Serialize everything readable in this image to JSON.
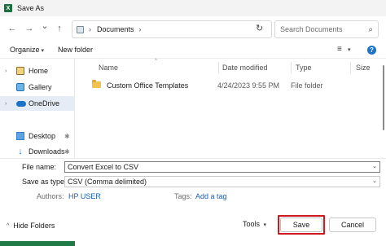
{
  "window": {
    "title": "Save As",
    "app_icon": "excel-icon"
  },
  "nav": {
    "back_icon": "←",
    "forward_icon": "→",
    "dropdown_icon": "⌄",
    "up_icon": "↑",
    "breadcrumb": [
      "Documents"
    ],
    "refresh_icon": "↻",
    "search_placeholder": "Search Documents",
    "search_icon": "⌕"
  },
  "commandbar": {
    "organize_label": "Organize",
    "new_folder_label": "New folder",
    "view_icon": "≡",
    "help_icon": "?"
  },
  "sidebar": {
    "items": [
      {
        "label": "Home",
        "icon": "home-icon",
        "selected": false
      },
      {
        "label": "Gallery",
        "icon": "gallery-icon",
        "selected": false
      },
      {
        "label": "OneDrive",
        "icon": "onedrive-icon",
        "selected": true
      },
      {
        "label": "Desktop",
        "icon": "desktop-icon",
        "pinned": true
      },
      {
        "label": "Downloads",
        "icon": "downloads-icon",
        "pinned": true
      }
    ]
  },
  "filelist": {
    "columns": [
      "Name",
      "Date modified",
      "Type",
      "Size"
    ],
    "rows": [
      {
        "name": "Custom Office Templates",
        "date": "4/24/2023 9:55 PM",
        "type": "File folder",
        "size": ""
      }
    ]
  },
  "form": {
    "filename_label": "File name:",
    "filename_value": "Convert Excel to CSV",
    "savetype_label": "Save as type:",
    "savetype_value": "CSV (Comma delimited)",
    "authors_label": "Authors:",
    "authors_value": "HP USER",
    "tags_label": "Tags:",
    "tags_value": "Add a tag"
  },
  "footer": {
    "hide_folders_label": "Hide Folders",
    "tools_label": "Tools",
    "save_label": "Save",
    "cancel_label": "Cancel"
  },
  "colors": {
    "accent": "#1a73c7",
    "highlight": "#d0191f",
    "excel": "#1f7a45"
  }
}
